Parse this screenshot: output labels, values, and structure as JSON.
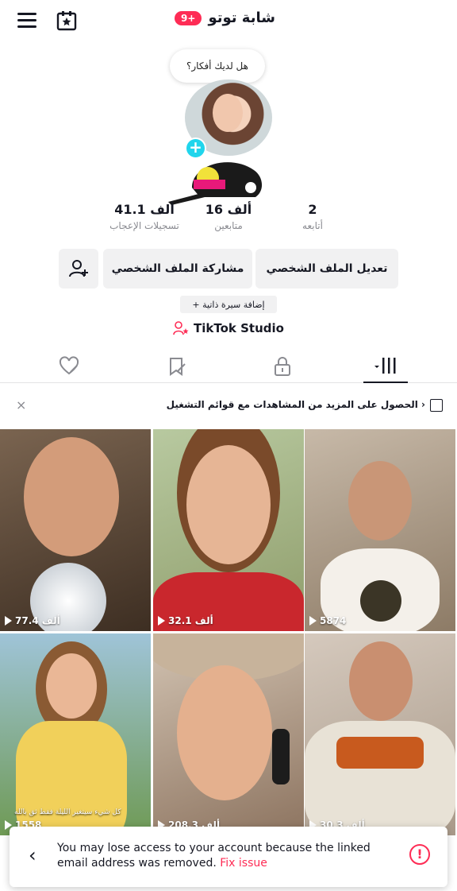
{
  "header": {
    "title": "شابة توتو",
    "notification_badge": "9+"
  },
  "profile": {
    "thought_prompt": "هل لديك أفكار؟"
  },
  "stats": [
    {
      "value": "2",
      "label": "أتابعه"
    },
    {
      "value": "16 ألف",
      "label": "متابعين"
    },
    {
      "value": "41.1 ألف",
      "label": "تسجيلات الإعجاب"
    }
  ],
  "actions": {
    "edit_profile": "تعديل الملف الشخصي",
    "share_profile": "مشاركة الملف الشخصي",
    "add_bio": "+ إضافة سيرة ذاتية",
    "studio": "TikTok Studio"
  },
  "banner": {
    "text": "الحصول على المزيد من المشاهدات مع قوائم التشغيل ›",
    "close": "×"
  },
  "videos": [
    {
      "views": "5874",
      "caption": ""
    },
    {
      "views": "32.1 ألف",
      "caption": ""
    },
    {
      "views": "77.4 ألف",
      "caption": ""
    },
    {
      "views": "30.3 ألف",
      "caption": ""
    },
    {
      "views": "208.3 ألف",
      "caption": ""
    },
    {
      "views": "1558",
      "caption": "كل شيء سيتغير الليلة فقط ثق بالله"
    }
  ],
  "toast": {
    "message": "You may lose access to your account because the linked email address was removed.",
    "action": "Fix issue",
    "alert": "!"
  },
  "colors": {
    "accent": "#fe2c55",
    "avatar_add": "#20d5ec"
  }
}
